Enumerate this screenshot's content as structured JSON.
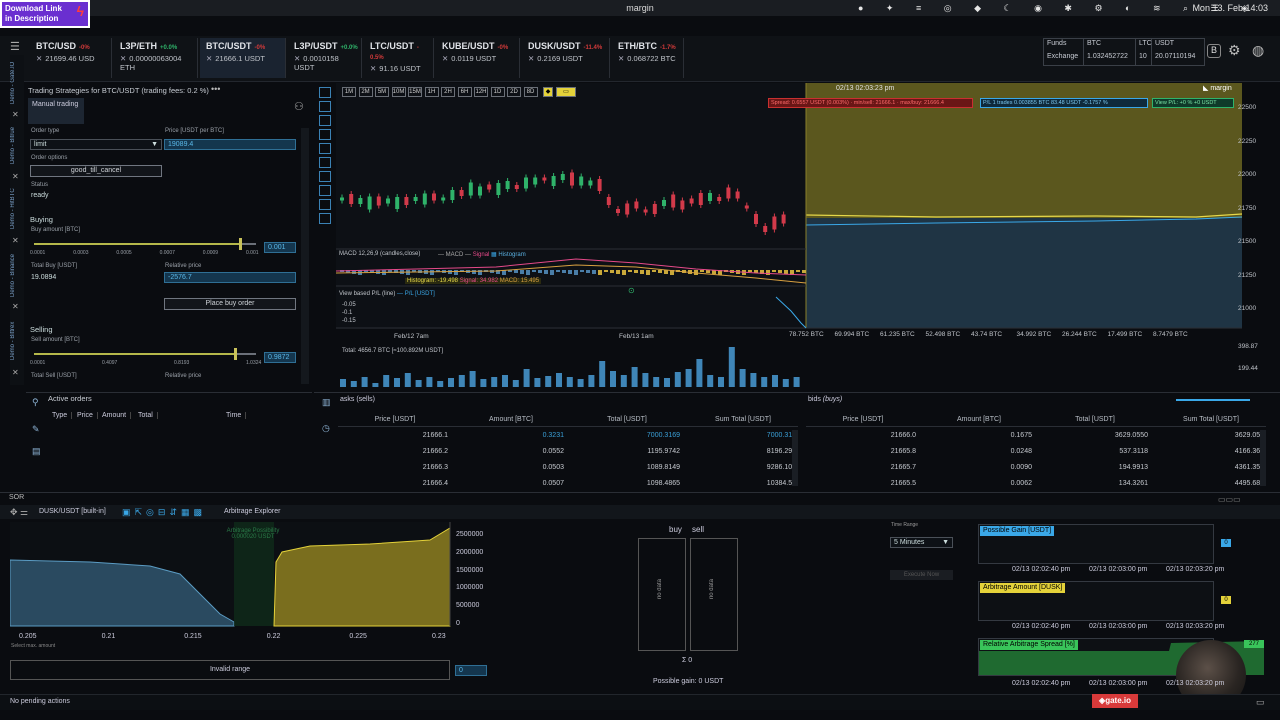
{
  "menubar": {
    "title": "margin",
    "clock": "Mon 13. Feb 14:03"
  },
  "banner": {
    "line1": "Download Link",
    "line2": "in Description"
  },
  "tabs": [
    {
      "name": "BTC/USD",
      "pct": "-0%",
      "sub": "21699.46 USD"
    },
    {
      "name": "L3P/ETH",
      "pct": "+0.0%",
      "sub": "0.00000063004 ETH"
    },
    {
      "name": "BTC/USDT",
      "pct": "-0%",
      "sub": "21666.1 USDT"
    },
    {
      "name": "L3P/USDT",
      "pct": "+0.0%",
      "sub": "0.0010158 USDT"
    },
    {
      "name": "LTC/USDT",
      "pct": "-0.5%",
      "sub": "91.16 USDT"
    },
    {
      "name": "KUBE/USDT",
      "pct": "-0%",
      "sub": "0.0119 USDT"
    },
    {
      "name": "DUSK/USDT",
      "pct": "-11.4%",
      "sub": "0.2169 USDT"
    },
    {
      "name": "ETH/BTC",
      "pct": "-1.7%",
      "sub": "0.068722 BTC"
    }
  ],
  "funds": {
    "funds_label": "Funds",
    "exchange_label": "Exchange",
    "btc_label": "BTC",
    "btc_value": "1.032452722",
    "ltc_label": "LTC",
    "ltc_value": "10",
    "usdt_label": "USDT",
    "usdt_value": "20.07110194"
  },
  "rail": [
    "Demo - Gate.IO",
    "Demo - Bitrue",
    "Demo - HitBTC",
    "Demo - Binance",
    "Demo - Bittrex"
  ],
  "strategy": {
    "title": "Trading Strategies for BTC/USDT (trading fees: 0.2 %)",
    "more": "•••",
    "manual_tab": "Manual trading",
    "order_type_label": "Order type",
    "order_type_value": "limit",
    "price_label": "Price [USDT per BTC]",
    "price_value": "19089.4",
    "order_options_label": "Order options",
    "order_options_value": "good_till_cancel",
    "status_label": "Status",
    "status_value": "ready",
    "buying_label": "Buying",
    "buy_amount_label": "Buy amount [BTC]",
    "buy_ticks": [
      "0.0001",
      "0.0003",
      "0.0005",
      "0.0007",
      "0.0009",
      "0.001"
    ],
    "buy_amount_value": "0.001",
    "total_buy_label": "Total Buy [USDT]",
    "total_buy_value": "19.0894",
    "relative_price_label": "Relative price",
    "relative_price_value": "-2576.7",
    "place_buy": "Place buy order",
    "selling_label": "Selling",
    "sell_amount_label": "Sell amount [BTC]",
    "sell_ticks": [
      "0.0001",
      "0.4097",
      "0.8193",
      "1.0324"
    ],
    "sell_amount_value": "0.9872",
    "total_sell_label": "Total Sell [USDT]",
    "relative_price_label2": "Relative price"
  },
  "active_orders": {
    "title": "Active orders",
    "columns": [
      "Type",
      "Price",
      "Amount",
      "Total",
      "Time"
    ]
  },
  "chart": {
    "timeframes": [
      "1M",
      "2M",
      "5M",
      "10M",
      "15M",
      "1H",
      "2H",
      "6H",
      "12H",
      "1D",
      "2D",
      "8D"
    ],
    "timestamp": "02/13 02:03:23 pm",
    "spread_badge": "Spread: 0.6557 USDT (0.003%) · min/sell: 21666.1 · max/buy: 21666.4",
    "pl_badge": "P/L 1 trades 0.003855 BTC 83.48 USDT -0.1757 %",
    "view_pl_badge": "View P/L: +0 % +0 USDT",
    "logo": "margin",
    "price_ticks": [
      "22500",
      "22250",
      "22000",
      "21750",
      "21500",
      "21250",
      "21000"
    ],
    "macd_label": "MACD 12,26,9 (candles,close)",
    "macd_legend": [
      "MACD",
      "Signal",
      "Histogram"
    ],
    "histogram_label": "Histogram: -19.498",
    "signal_label": "Signal: 34.982",
    "macd_value": "MACD: 15.495",
    "view_pl_label": "View based P/L (line)",
    "pl_usdt": "P/L [USDT]",
    "pl_ticks": [
      "-0.05",
      "-0.1",
      "-0.15"
    ],
    "x_labels": [
      "Feb/12 7am",
      "Feb/13 1am"
    ],
    "depth_labels": [
      "78.752 BTC",
      "69.994 BTC",
      "61.235 BTC",
      "52.498 BTC",
      "43.74 BTC",
      "34.992 BTC",
      "26.244 BTC",
      "17.499 BTC",
      "8.7479 BTC"
    ],
    "volume_total": "Total: 4656.7 BTC [≈100.892M USDT]",
    "volume_ticks": [
      "398.87",
      "199.44"
    ]
  },
  "asks": {
    "title": "asks (sells)",
    "columns": [
      "Price [USDT]",
      "Amount [BTC]",
      "Total [USDT]",
      "Sum Total [USDT]"
    ],
    "rows": [
      [
        "21666.1",
        "0.3231",
        "7000.3169",
        "7000.316"
      ],
      [
        "21666.2",
        "0.0552",
        "1195.9742",
        "8196.291"
      ],
      [
        "21666.3",
        "0.0503",
        "1089.8149",
        "9286.106"
      ],
      [
        "21666.4",
        "0.0507",
        "1098.4865",
        "10384.59"
      ]
    ]
  },
  "bids": {
    "title": "bids",
    "title_suffix": "(buys)",
    "columns": [
      "Price [USDT]",
      "Amount [BTC]",
      "Total [USDT]",
      "Sum Total [USDT]"
    ],
    "rows": [
      [
        "21666.0",
        "0.1675",
        "3629.0550",
        "3629.055"
      ],
      [
        "21665.8",
        "0.0248",
        "537.3118",
        "4166.366"
      ],
      [
        "21665.7",
        "0.0090",
        "194.9913",
        "4361.358"
      ],
      [
        "21665.5",
        "0.0062",
        "134.3261",
        "4495.684"
      ]
    ]
  },
  "sor": {
    "label": "SOR",
    "pair": "DUSK/USDT [built-in]",
    "explorer": "Arbitrage Explorer",
    "arb_note": "Arbitrage Possibility",
    "arb_value": "0.000020 USDT",
    "y_ticks": [
      "2500000",
      "2000000",
      "1500000",
      "1000000",
      "500000",
      "0"
    ],
    "x_ticks": [
      "0.205",
      "0.21",
      "0.215",
      "0.22",
      "0.225",
      "0.23"
    ],
    "select_label": "Select max. amount",
    "invalid_range": "Invalid range",
    "small_input": "0",
    "buy": "buy",
    "sell": "sell",
    "no_data": "no data",
    "sigma": "Σ 0",
    "possible_gain": "Possible gain: 0 USDT",
    "time_range_label": "Time Range",
    "time_range_value": "5 Minutes",
    "execute": "Execute Now",
    "possible_gain_box": "Possible Gain [USDT]",
    "arb_amount_box": "Arbitrage Amount [DUSK]",
    "rel_spread_box": "Relative Arbitrage Spread [%]",
    "side_value_1": "0",
    "side_value_2": "0",
    "side_value_3": "277",
    "times": [
      "02/13 02:02:40 pm",
      "02/13 02:03:00 pm",
      "02/13 02:03:20 pm"
    ]
  },
  "status": {
    "pending": "No pending actions",
    "gate": "gate.io"
  },
  "colors": {
    "accent": "#3aa8e8",
    "up": "#2fb36a",
    "down": "#d23a4a",
    "yellow": "#e4d23a"
  }
}
